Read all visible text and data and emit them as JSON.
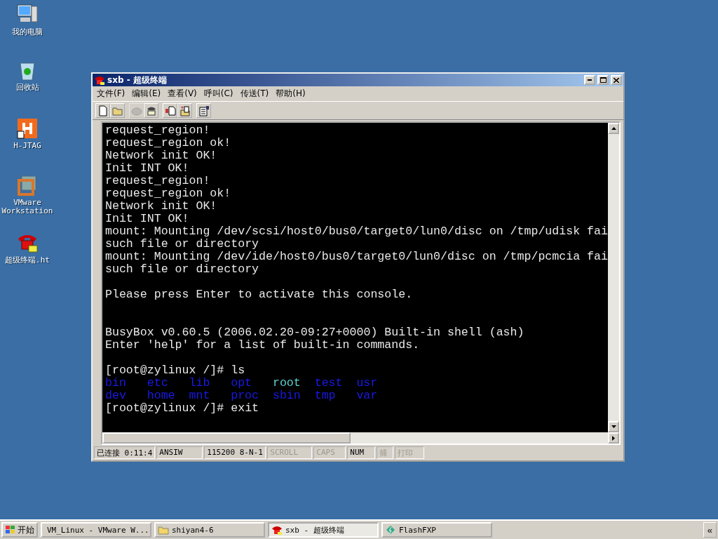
{
  "desktop_icons": [
    {
      "kind": "computer",
      "label": "我的电脑"
    },
    {
      "kind": "recycle",
      "label": "回收站"
    },
    {
      "kind": "hjtag",
      "label": "H-JTAG"
    },
    {
      "kind": "vmware",
      "label": "VMware Workstation"
    },
    {
      "kind": "phone",
      "label": "超级终端.ht"
    }
  ],
  "window": {
    "title": "sxb - 超级终端",
    "menu": [
      "文件(F)",
      "编辑(E)",
      "查看(V)",
      "呼叫(C)",
      "传送(T)",
      "帮助(H)"
    ],
    "toolbar": [
      [
        {
          "kind": "new",
          "disabled": false
        },
        {
          "kind": "open",
          "disabled": false
        }
      ],
      [
        {
          "kind": "disconnect",
          "disabled": true
        },
        {
          "kind": "dial",
          "disabled": false
        }
      ],
      [
        {
          "kind": "send",
          "disabled": false
        },
        {
          "kind": "receive",
          "disabled": false
        }
      ],
      [
        {
          "kind": "properties",
          "disabled": false
        }
      ]
    ],
    "terminal": [
      {
        "kind": "text",
        "text": "request_region!"
      },
      {
        "kind": "text",
        "text": "request_region ok!"
      },
      {
        "kind": "text",
        "text": "Network init OK!"
      },
      {
        "kind": "text",
        "text": "Init INT OK!"
      },
      {
        "kind": "text",
        "text": "request_region!"
      },
      {
        "kind": "text",
        "text": "request_region ok!"
      },
      {
        "kind": "text",
        "text": "Network init OK!"
      },
      {
        "kind": "text",
        "text": "Init INT OK!"
      },
      {
        "kind": "text",
        "text": "mount: Mounting /dev/scsi/host0/bus0/target0/lun0/disc on /tmp/udisk fai"
      },
      {
        "kind": "text",
        "text": "such file or directory"
      },
      {
        "kind": "text",
        "text": "mount: Mounting /dev/ide/host0/bus0/target0/lun0/disc on /tmp/pcmcia fai"
      },
      {
        "kind": "text",
        "text": "such file or directory"
      },
      {
        "kind": "blank"
      },
      {
        "kind": "text",
        "text": "Please press Enter to activate this console."
      },
      {
        "kind": "blank"
      },
      {
        "kind": "blank"
      },
      {
        "kind": "text",
        "text": "BusyBox v0.60.5 (2006.02.20-09:27+0000) Built-in shell (ash)"
      },
      {
        "kind": "text",
        "text": "Enter 'help' for a list of built-in commands."
      },
      {
        "kind": "blank"
      },
      {
        "kind": "text",
        "text": "[root@zylinux /]# ls"
      },
      {
        "kind": "listing",
        "entries": [
          {
            "text": "bin",
            "color": "#1a1ae6"
          },
          {
            "text": "etc",
            "color": "#1a1ae6"
          },
          {
            "text": "lib",
            "color": "#1a1ae6"
          },
          {
            "text": "opt",
            "color": "#1a1ae6"
          },
          {
            "text": "root",
            "color": "#5ad2d2"
          },
          {
            "text": "test",
            "color": "#1a1ae6"
          },
          {
            "text": "usr",
            "color": "#1a1ae6"
          }
        ]
      },
      {
        "kind": "listing",
        "entries": [
          {
            "text": "dev",
            "color": "#1a1ae6"
          },
          {
            "text": "home",
            "color": "#1a1ae6"
          },
          {
            "text": "mnt",
            "color": "#1a1ae6"
          },
          {
            "text": "proc",
            "color": "#1a1ae6"
          },
          {
            "text": "sbin",
            "color": "#1a1ae6"
          },
          {
            "text": "tmp",
            "color": "#1a1ae6"
          },
          {
            "text": "var",
            "color": "#1a1ae6"
          }
        ]
      },
      {
        "kind": "text",
        "text": "[root@zylinux /]# exit"
      }
    ],
    "status_bar": [
      {
        "text": "已连接 0:11:4",
        "disabled": false
      },
      {
        "text": "ANSIW",
        "disabled": false
      },
      {
        "text": "115200 8-N-1",
        "disabled": false
      },
      {
        "text": "SCROLL",
        "disabled": true
      },
      {
        "text": "CAPS",
        "disabled": true
      },
      {
        "text": "NUM",
        "disabled": false
      },
      {
        "text": "捕",
        "disabled": true
      },
      {
        "text": "打印",
        "disabled": true
      }
    ]
  },
  "taskbar": {
    "start": "开始",
    "tasks": [
      {
        "kind": "vmware",
        "label": "VM_Linux - VMware W...",
        "selected": false
      },
      {
        "kind": "folder",
        "label": "shiyan4-6",
        "selected": false
      },
      {
        "kind": "phone",
        "label": "sxb - 超级终端",
        "selected": true
      },
      {
        "kind": "ftp",
        "label": "FlashFXP",
        "selected": false
      }
    ],
    "chevron": "«"
  }
}
